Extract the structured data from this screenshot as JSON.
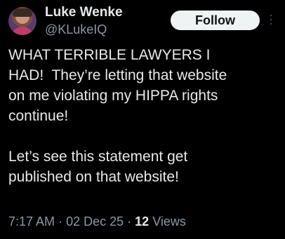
{
  "author": {
    "display_name": "Luke Wenke",
    "handle": "@KLukeIQ"
  },
  "actions": {
    "follow_label": "Follow",
    "more_icon": "more-vertical-icon"
  },
  "tweet": {
    "text": "WHAT TERRIBLE LAWYERS I\nHAD!  They’re letting that website\non me violating my HIPPA rights\ncontinue!\n\nLet’s see this statement get\npublished on that website!",
    "time": "7:17 AM",
    "date": "02 Dec 25",
    "separator": "·",
    "views_count": "12",
    "views_label": "Views"
  },
  "colors": {
    "background": "#000000",
    "primary_text": "#e7e9ea",
    "secondary_text": "#8b98a5",
    "follow_button_bg": "#eff3f4",
    "follow_button_text": "#0f1419"
  }
}
